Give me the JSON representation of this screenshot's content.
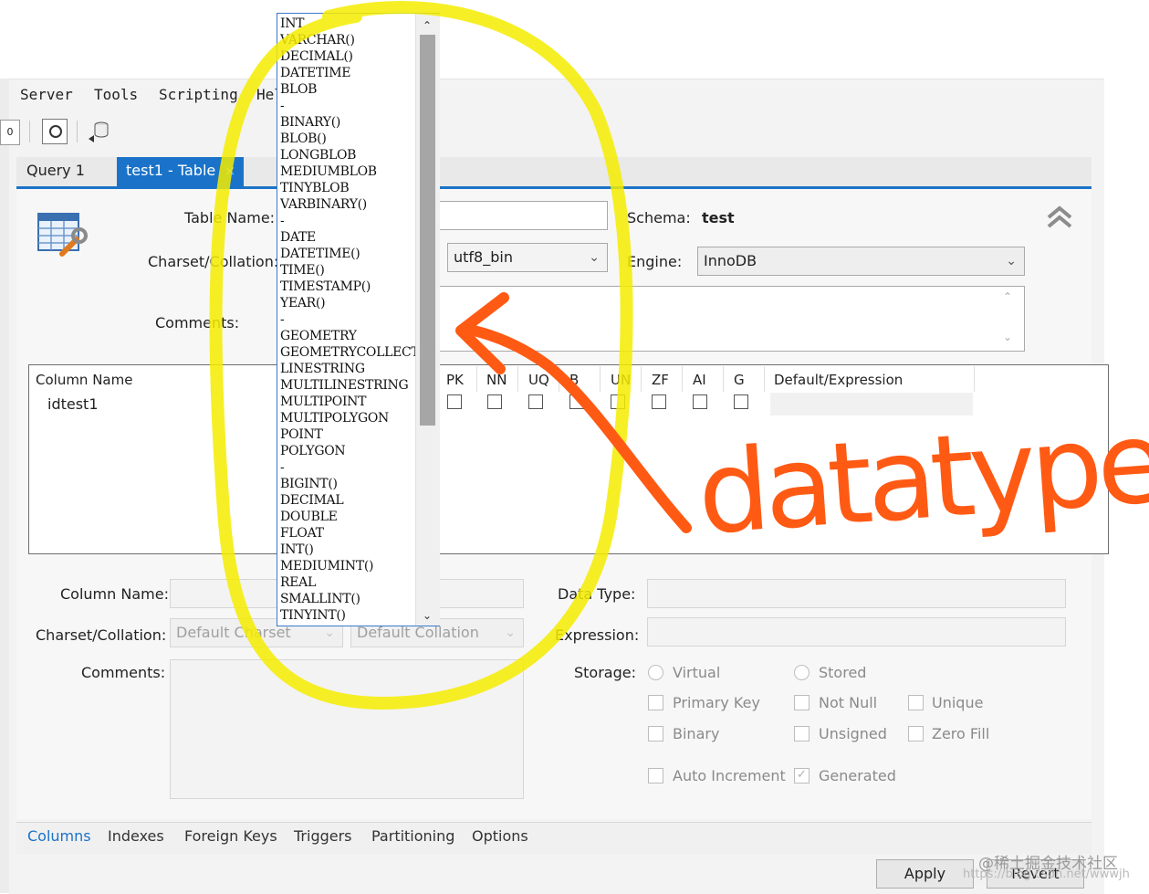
{
  "menu": [
    "Server",
    "Tools",
    "Scripting",
    "Hel"
  ],
  "tabs": {
    "query": "Query 1",
    "table": "test1 - Table",
    "close": "×"
  },
  "form": {
    "table_name_label": "Table Name:",
    "table_name_value": "",
    "schema_label": "Schema:",
    "schema_value": "test",
    "charset_label": "Charset/Collation:",
    "collation_value": "utf8_bin",
    "engine_label": "Engine:",
    "engine_value": "InnoDB",
    "comments_label": "Comments:"
  },
  "grid": {
    "headers": [
      "Column Name",
      "PK",
      "NN",
      "UQ",
      "B",
      "UN",
      "ZF",
      "AI",
      "G",
      "Default/Expression"
    ],
    "rows": [
      {
        "name": "idtest1"
      }
    ]
  },
  "details": {
    "column_name_label": "Column Name:",
    "charset_label": "Charset/Collation:",
    "charset_placeholder": "Default Charset",
    "collation_placeholder": "Default Collation",
    "comments_label": "Comments:",
    "data_type_label": "Data Type:",
    "expression_label": "Expression:",
    "storage_label": "Storage:",
    "virtual": "Virtual",
    "stored": "Stored",
    "primary_key": "Primary Key",
    "not_null": "Not Null",
    "unique": "Unique",
    "binary": "Binary",
    "unsigned": "Unsigned",
    "zero_fill": "Zero Fill",
    "auto_increment": "Auto Increment",
    "generated": "Generated"
  },
  "bottom_tabs": [
    "Columns",
    "Indexes",
    "Foreign Keys",
    "Triggers",
    "Partitioning",
    "Options"
  ],
  "buttons": {
    "apply": "Apply",
    "revert": "Revert"
  },
  "dropdown_items": [
    "INT",
    "VARCHAR()",
    "DECIMAL()",
    "DATETIME",
    "BLOB",
    "-",
    "BINARY()",
    "BLOB()",
    "LONGBLOB",
    "MEDIUMBLOB",
    "TINYBLOB",
    "VARBINARY()",
    "-",
    "DATE",
    "DATETIME()",
    "TIME()",
    "TIMESTAMP()",
    "YEAR()",
    "-",
    "GEOMETRY",
    "GEOMETRYCOLLECTIO",
    "LINESTRING",
    "MULTILINESTRING",
    "MULTIPOINT",
    "MULTIPOLYGON",
    "POINT",
    "POLYGON",
    "-",
    "BIGINT()",
    "DECIMAL",
    "DOUBLE",
    "FLOAT",
    "INT()",
    "MEDIUMINT()",
    "REAL",
    "SMALLINT()",
    "TINYINT()"
  ],
  "annotation": {
    "text": "datatypes",
    "color": "#ff5a14",
    "highlight_color": "#f5ec00"
  },
  "watermark": {
    "line1": "@稀土掘金技术社区",
    "line2": "https://blog.csdn.net/wwwjh"
  },
  "colors": {
    "accent": "#1a73c8"
  }
}
